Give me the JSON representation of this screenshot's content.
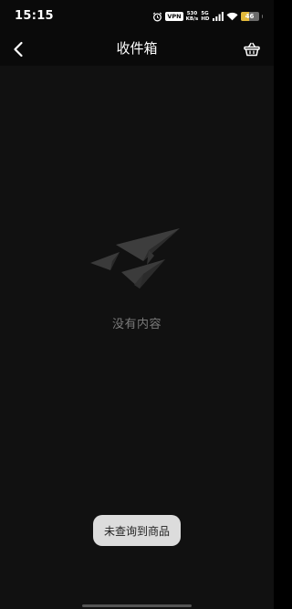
{
  "status_bar": {
    "time": "15:15",
    "vpn": "VPN",
    "speed_value": "530",
    "speed_unit": "KB/s",
    "network_top": "5G",
    "network_bottom": "HD",
    "battery": "46",
    "battery_level": 0.46,
    "battery_color": "#e3b93a",
    "icons": [
      "alarm-icon",
      "signal-icon",
      "wifi-icon"
    ]
  },
  "nav": {
    "back_icon": "chevron-left-icon",
    "title": "收件箱",
    "basket_icon": "basket-icon"
  },
  "empty_state": {
    "illustration": "paper-planes-icon",
    "message": "没有内容"
  },
  "toast": {
    "message": "未查询到商品"
  },
  "colors": {
    "background": "#111111",
    "bar_background": "#0a0a0a",
    "muted_text": "#7a7a7a",
    "toast_background": "#dcdcdc"
  }
}
